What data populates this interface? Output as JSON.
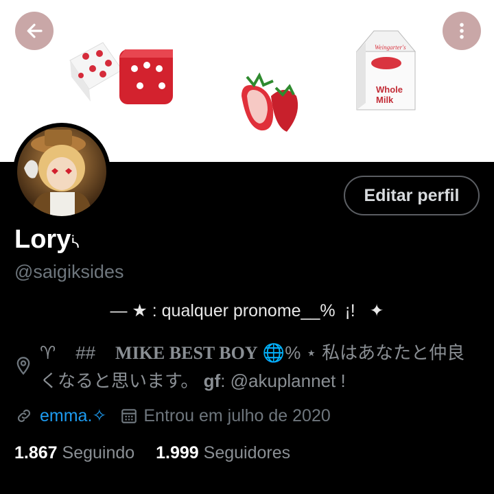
{
  "header": {
    "back_icon": "arrow-left-icon",
    "more_icon": "more-vertical-icon",
    "banner_milk_text": "Whole Milk",
    "banner_milk_brand": "Weingarter's"
  },
  "profile": {
    "edit_label": "Editar perfil",
    "name": "Lory",
    "name_suffix": "ᓵ",
    "handle": "@saigiksides",
    "pronoun_line": "— ★ : qualquer pronome__%  ¡!   ✦",
    "bio_part1": "♈    ##    ",
    "bio_mike": "MIKE BEST BOY",
    "bio_part2": " 🌐%    ⋆ 私はあなたと仲良くなると思います。",
    "bio_gf_label": "gf",
    "bio_gf_text": ": @akuplannet !",
    "link_text": "emma.✧",
    "joined_text": "Entrou em julho de 2020",
    "following_count": "1.867",
    "following_label": "Seguindo",
    "followers_count": "1.999",
    "followers_label": "Seguidores"
  },
  "colors": {
    "accent": "#1d9bf0",
    "header_button": "#c9a7a7",
    "muted": "#6e767d"
  }
}
